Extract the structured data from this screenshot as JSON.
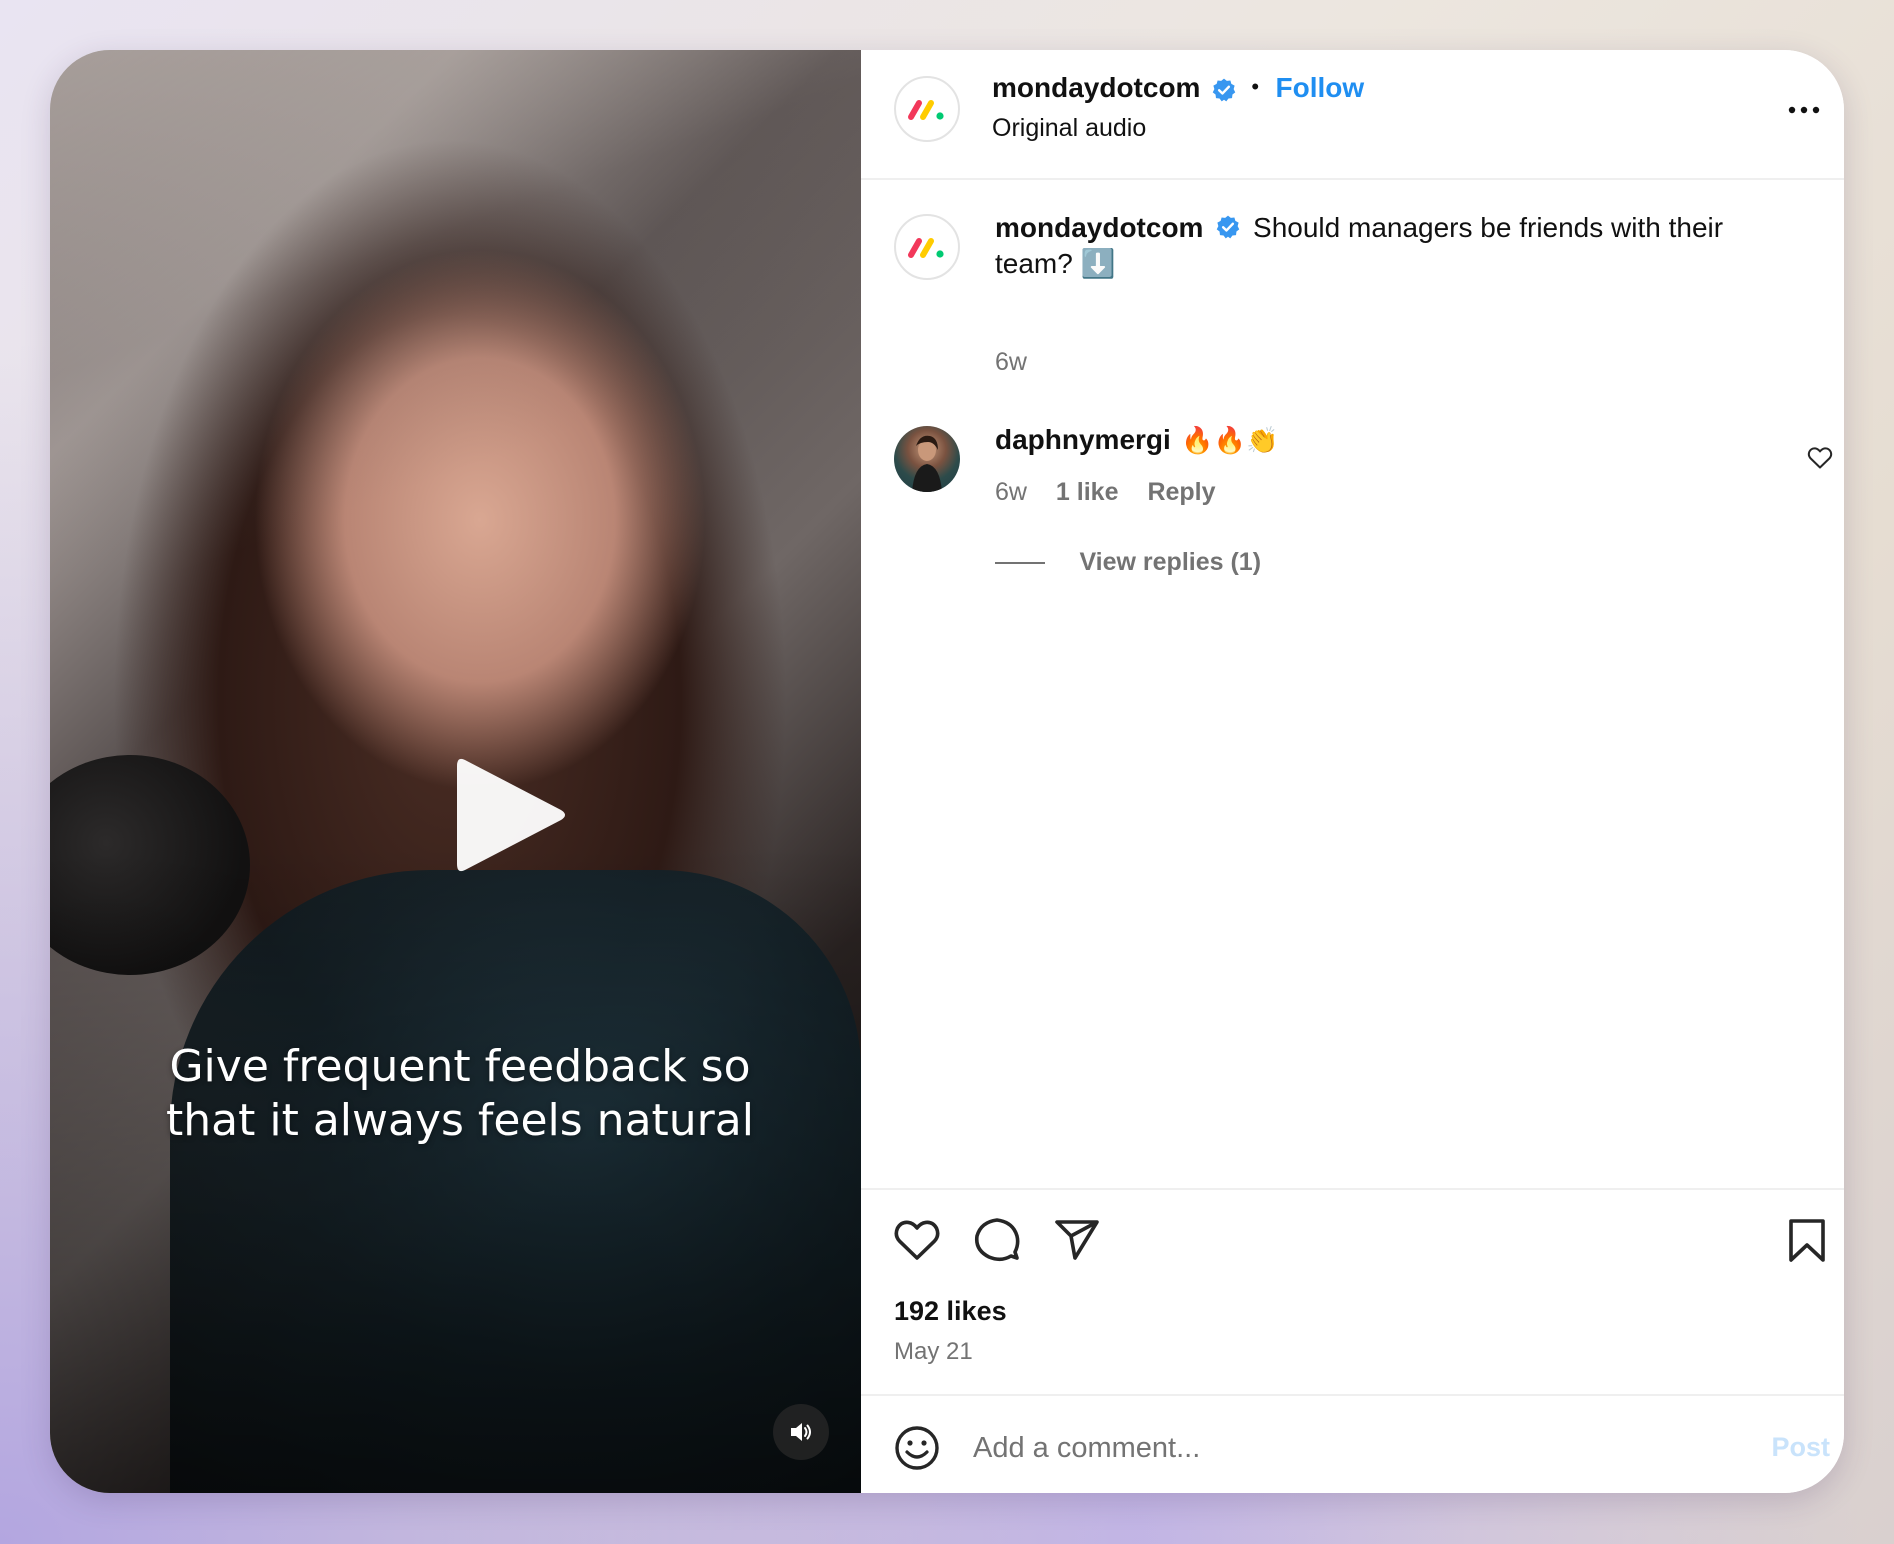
{
  "video": {
    "caption_line1": "Give frequent feedback so",
    "caption_line2": "that it always feels natural"
  },
  "header": {
    "username": "mondaydotcom",
    "separator": "•",
    "follow_label": "Follow",
    "audio_label": "Original audio"
  },
  "post": {
    "username": "mondaydotcom",
    "caption_text": "Should managers be friends with their team?",
    "caption_emoji": "⬇️",
    "age": "6w"
  },
  "comments": [
    {
      "username": "daphnymergi",
      "text": "🔥🔥👏",
      "age": "6w",
      "likes": "1 like",
      "reply_label": "Reply",
      "view_replies_label": "View replies (1)"
    }
  ],
  "stats": {
    "likes": "192 likes",
    "date": "May 21"
  },
  "composer": {
    "placeholder": "Add a comment...",
    "post_label": "Post"
  },
  "colors": {
    "link_blue": "#1f8ef1",
    "verified_blue": "#3897f0",
    "muted_text": "#737373",
    "post_disabled": "#c9e3fb"
  }
}
